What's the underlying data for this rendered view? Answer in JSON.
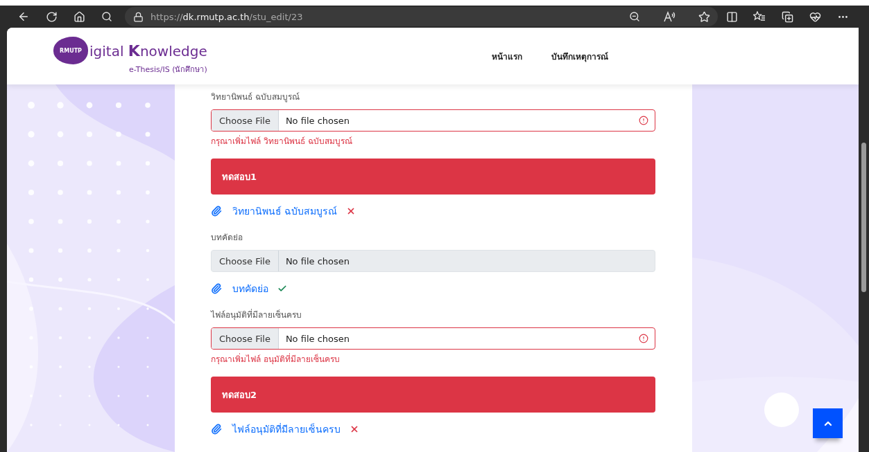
{
  "browser": {
    "url": {
      "scheme": "https://",
      "host": "dk.rmutp.ac.th",
      "path": "/stu_edit/23"
    }
  },
  "header": {
    "logo": {
      "badge": "RMUTP",
      "title": "igital **K**nowledge",
      "subtitle": "e-Thesis/IS (นักศึกษา)"
    },
    "nav": [
      {
        "label": "หน้าแรก"
      },
      {
        "label": "บันทึกเหตุการณ์"
      }
    ]
  },
  "form": [
    {
      "kind": "label",
      "text": "วิทยานิพนธ์ ฉบับสมบูรณ์"
    },
    {
      "kind": "file",
      "button": "Choose File",
      "value": "No file chosen",
      "invalid": true,
      "disabled": false
    },
    {
      "kind": "error",
      "text": "กรุณาเพิ่มไฟล์ วิทยานิพนธ์ ฉบับสมบูรณ์"
    },
    {
      "kind": "banner",
      "text": "ทดสอบ1"
    },
    {
      "kind": "attachment",
      "text": "วิทยานิพนธ์ ฉบับสมบูรณ์",
      "approved": false
    },
    {
      "kind": "label",
      "text": "บทคัดย่อ"
    },
    {
      "kind": "file",
      "button": "Choose File",
      "value": "No file chosen",
      "invalid": false,
      "disabled": true
    },
    {
      "kind": "attachment",
      "text": "บทคัดย่อ",
      "approved": true
    },
    {
      "kind": "label",
      "text": "ไฟล์อนุมัติที่มีลายเซ็นครบ"
    },
    {
      "kind": "file",
      "button": "Choose File",
      "value": "No file chosen",
      "invalid": true,
      "disabled": false
    },
    {
      "kind": "error",
      "text": "กรุณาเพิ่มไฟล์ อนุมัติที่มีลายเซ็นครบ"
    },
    {
      "kind": "banner",
      "text": "ทดสอบ2"
    },
    {
      "kind": "attachment",
      "text": "ไฟล์อนุมัติที่มีลายเซ็นครบ",
      "approved": false
    }
  ]
}
